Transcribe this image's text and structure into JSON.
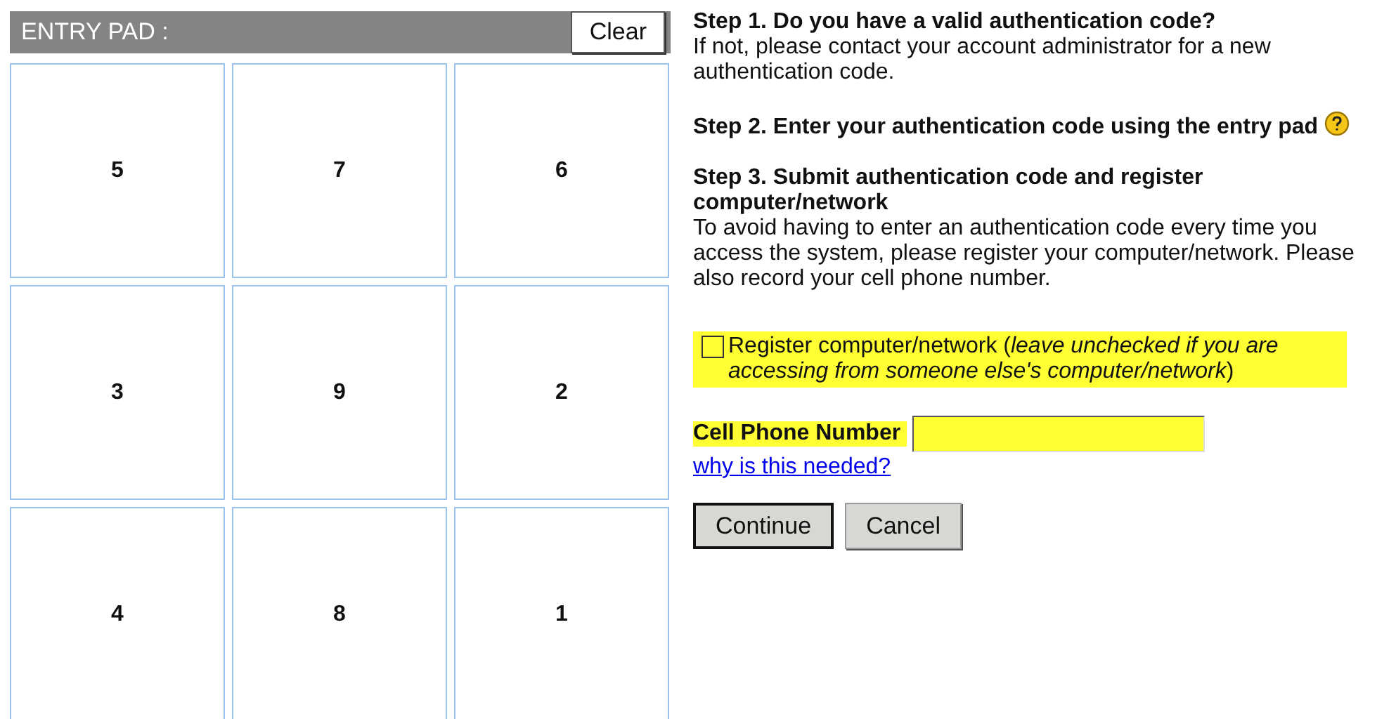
{
  "entry_pad": {
    "title": "ENTRY PAD :",
    "clear_button": "Clear",
    "keys": [
      "5",
      "7",
      "6",
      "3",
      "9",
      "2",
      "4",
      "8",
      "1"
    ]
  },
  "steps": [
    {
      "heading": "Step 1. Do you have a valid authentication code?",
      "text": "If not, please contact your account administrator for a new authentication code.",
      "help": false
    },
    {
      "heading": "Step 2. Enter your authentication code using the entry pad",
      "help": true
    },
    {
      "heading": "Step 3. Submit authentication code and register computer/network",
      "text": "To avoid having to enter an authentication code every time you access the system, please register your computer/network. Please also record your cell phone number.",
      "help": false
    }
  ],
  "register": {
    "label": "Register computer/network (*leave unchecked if you are accessing from someone else's computer/network*)",
    "checked": false
  },
  "cell_phone": {
    "label": "Cell Phone Number"
  },
  "why_link": "why is this needed?",
  "buttons": [
    "Continue",
    "Cancel"
  ]
}
